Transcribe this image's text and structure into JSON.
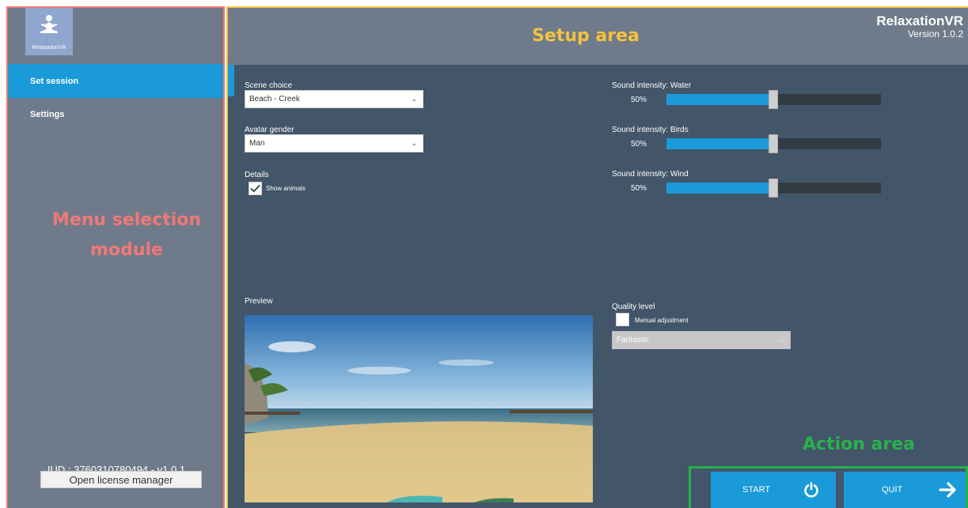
{
  "logo": {
    "text": "RelaxationVR"
  },
  "menu": {
    "items": [
      {
        "label": "Set session",
        "active": true
      },
      {
        "label": "Settings",
        "active": false
      }
    ]
  },
  "footer": {
    "iud": "IUD : 3760310780494 - v1.0.1",
    "license_button": "Open license manager"
  },
  "header": {
    "app_name": "RelaxationVR",
    "version": "Version 1.0.2"
  },
  "setup": {
    "scene_choice": {
      "label": "Scene choice",
      "value": "Beach - Creek"
    },
    "avatar_gender": {
      "label": "Avatar gender",
      "value": "Man"
    },
    "details": {
      "label": "Details",
      "show_animals_label": "Show animals",
      "show_animals_checked": true
    },
    "sound": [
      {
        "label": "Sound intensity: Water",
        "value_text": "50%",
        "value": 0.5
      },
      {
        "label": "Sound intensity: Birds",
        "value_text": "50%",
        "value": 0.5
      },
      {
        "label": "Sound intensity: Wind",
        "value_text": "50%",
        "value": 0.5
      }
    ],
    "preview_label": "Preview",
    "quality": {
      "label": "Quality level",
      "manual_label": "Manual adjustment",
      "manual_checked": false,
      "value": "Fantastic"
    }
  },
  "actions": {
    "start": "START",
    "quit": "QUIT"
  },
  "annotations": {
    "menu": "Menu selection module",
    "setup": "Setup area",
    "action": "Action area"
  },
  "colors": {
    "accent": "#1a9ad8",
    "panel": "#6f7b8a",
    "content": "#425569",
    "menu_annotation": "#f07878",
    "setup_annotation": "#f4c23d",
    "action_annotation": "#27b24a"
  },
  "icons": {
    "logo": "meditation-icon",
    "start": "power-icon",
    "quit": "arrow-right-icon"
  }
}
